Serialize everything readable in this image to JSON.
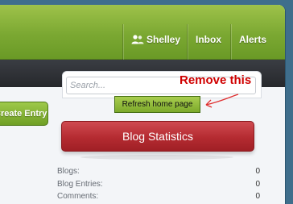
{
  "nav": {
    "user_label": "Shelley",
    "inbox_label": "Inbox",
    "alerts_label": "Alerts"
  },
  "search": {
    "placeholder": "Search..."
  },
  "annotation": {
    "text": "Remove this",
    "color": "#d00000"
  },
  "buttons": {
    "refresh_label": "Refresh home page",
    "create_label": "Create Entry",
    "stats_label": "Blog Statistics"
  },
  "stats": [
    {
      "label": "Blogs:",
      "value": "0"
    },
    {
      "label": "Blog Entries:",
      "value": "0"
    },
    {
      "label": "Comments:",
      "value": "0"
    }
  ],
  "colors": {
    "topbar": "#7ba832",
    "darkbar": "#2e3035",
    "stats_button": "#b52b31",
    "accent_green": "#7daa2b"
  }
}
